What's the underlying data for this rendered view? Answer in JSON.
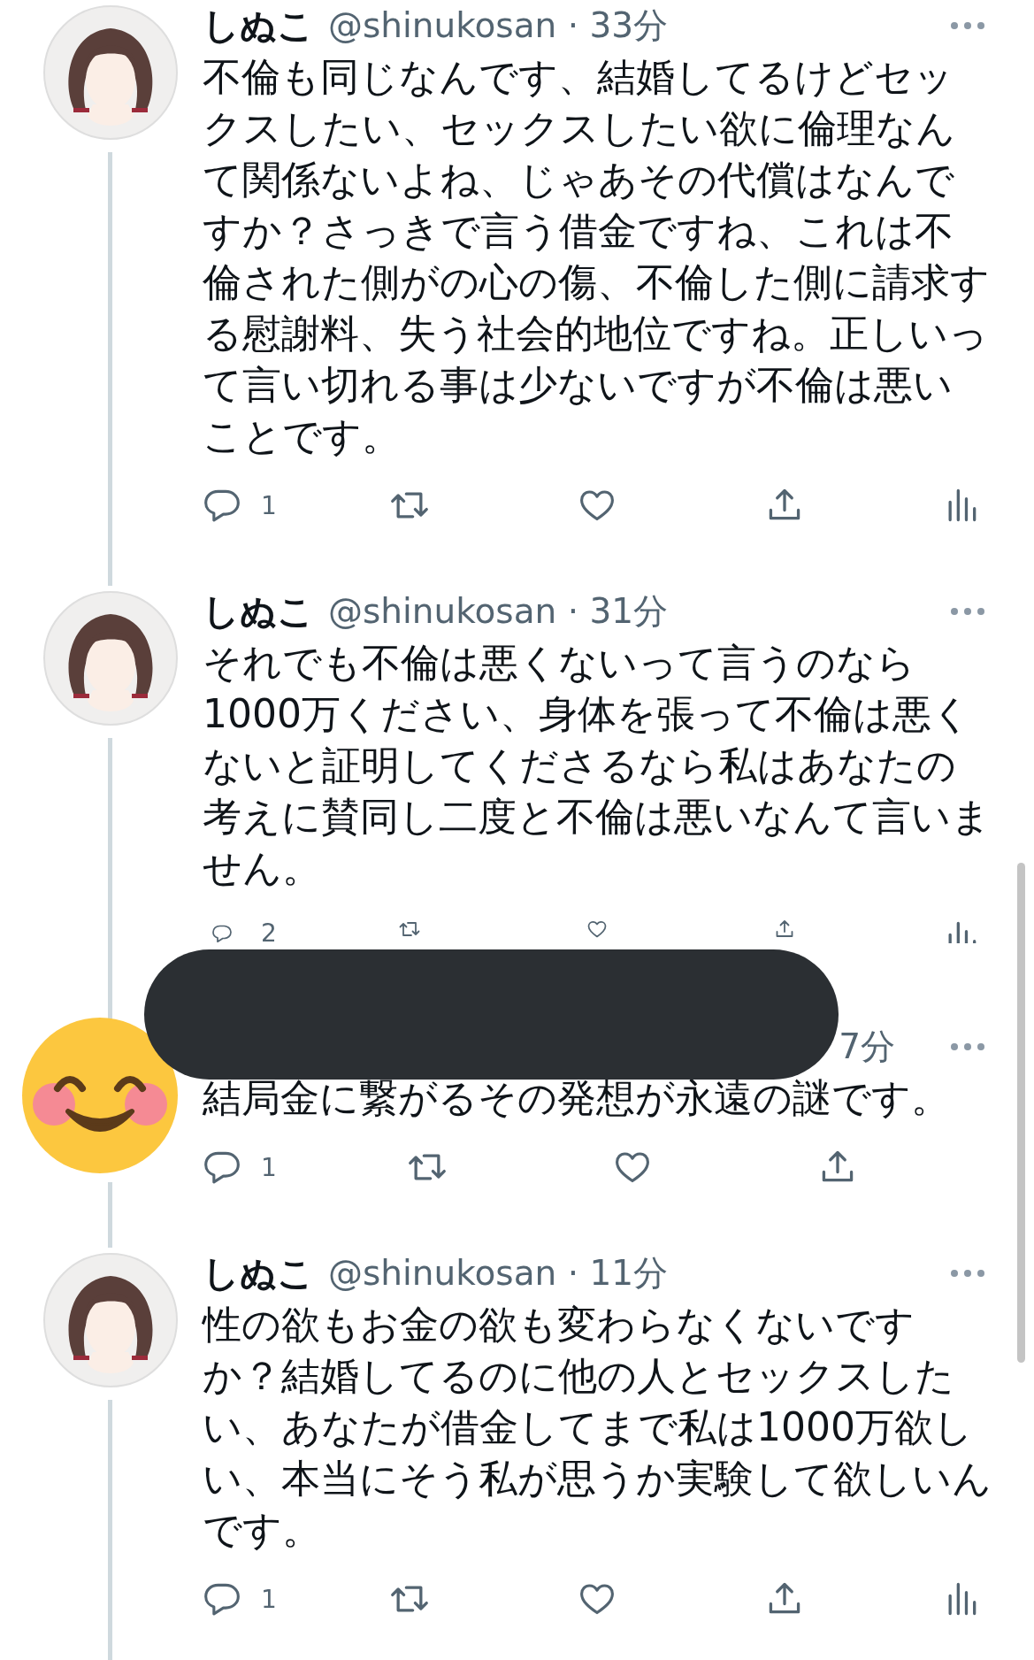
{
  "tweets": [
    {
      "avatar": {
        "kind": "illustration"
      },
      "name": "しぬこ",
      "handle_line": "@shinukosan · 33分",
      "text": "不倫も同じなんです、結婚してるけどセックスしたい、セックスしたい欲に倫理なんて関係ないよね、じゃあその代償はなんですか？さっきで言う借金ですね、これは不倫された側がの心の傷、不倫した側に請求する慰謝料、失う社会的地位ですね。正しいって言い切れる事は少ないですが不倫は悪いことです。",
      "actions": [
        {
          "kind": "reply",
          "count": "1"
        },
        {
          "kind": "retweet"
        },
        {
          "kind": "like"
        },
        {
          "kind": "share"
        },
        {
          "kind": "views"
        }
      ]
    },
    {
      "avatar": {
        "kind": "illustration"
      },
      "name": "しぬこ",
      "handle_line": "@shinukosan · 31分",
      "text": "それでも不倫は悪くないって言うのなら1000万ください、身体を張って不倫は悪くないと証明してくださるなら私はあなたの考えに賛同し二度と不倫は悪いなんて言いません。",
      "actions": [
        {
          "kind": "reply",
          "count": "2"
        },
        {
          "kind": "retweet"
        },
        {
          "kind": "like"
        },
        {
          "kind": "share"
        },
        {
          "kind": "views"
        }
      ]
    },
    {
      "avatar": {
        "kind": "emoji"
      },
      "time_fragment": "7分",
      "text": "結局金に繋がるその発想が永遠の謎です。",
      "actions": [
        {
          "kind": "reply",
          "count": "1"
        },
        {
          "kind": "retweet"
        },
        {
          "kind": "like"
        },
        {
          "kind": "share"
        }
      ]
    },
    {
      "avatar": {
        "kind": "illustration"
      },
      "name": "しぬこ",
      "handle_line": "@shinukosan · 11分",
      "text": "性の欲もお金の欲も変わらなくないですか？結婚してるのに他の人とセックスしたい、あなたが借金してまで私は1000万欲しい、本当にそう私が思うか実験して欲しいんです。",
      "actions": [
        {
          "kind": "reply",
          "count": "1"
        },
        {
          "kind": "retweet"
        },
        {
          "kind": "like"
        },
        {
          "kind": "share"
        },
        {
          "kind": "views"
        }
      ]
    }
  ]
}
